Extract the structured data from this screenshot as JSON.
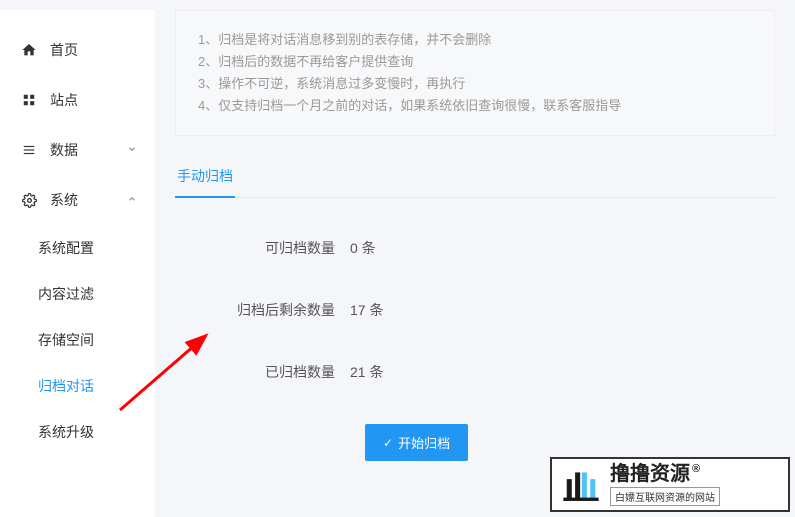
{
  "sidebar": {
    "items": [
      {
        "label": "首页",
        "icon": "home"
      },
      {
        "label": "站点",
        "icon": "grid"
      },
      {
        "label": "数据",
        "icon": "menu",
        "chevron": "down"
      },
      {
        "label": "系统",
        "icon": "gear",
        "chevron": "up"
      }
    ],
    "subitems": [
      {
        "label": "系统配置"
      },
      {
        "label": "内容过滤"
      },
      {
        "label": "存储空间"
      },
      {
        "label": "归档对话",
        "active": true
      },
      {
        "label": "系统升级"
      }
    ]
  },
  "notice": {
    "lines": [
      "1、归档是将对话消息移到别的表存储，并不会删除",
      "2、归档后的数据不再给客户提供查询",
      "3、操作不可逆，系统消息过多变慢时，再执行",
      "4、仅支持归档一个月之前的对话，如果系统依旧查询很慢，联系客服指导"
    ]
  },
  "tabs": {
    "manual": "手动归档"
  },
  "form": {
    "rows": [
      {
        "label": "可归档数量",
        "value": "0 条"
      },
      {
        "label": "归档后剩余数量",
        "value": "17 条"
      },
      {
        "label": "已归档数量",
        "value": "21 条"
      }
    ],
    "button": "开始归档"
  },
  "watermark": {
    "big": "撸撸资源",
    "reg": "®",
    "small": "白嫖互联网资源的网站"
  }
}
